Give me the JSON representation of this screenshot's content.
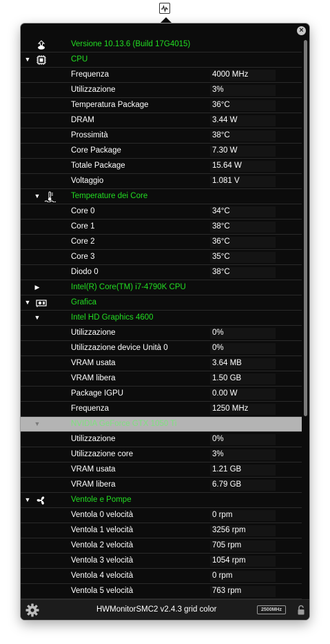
{
  "menubar": {
    "icon": "activity-monitor-icon"
  },
  "close": {
    "symbol": "×"
  },
  "rows": [
    {
      "type": "header",
      "indent": 0,
      "expand": "",
      "icon": "apple-os-icon",
      "label": "Versione 10.13.6 (Build 17G4015)",
      "value": ""
    },
    {
      "type": "header",
      "indent": 0,
      "expand": "down",
      "icon": "cpu-chip-icon",
      "label": "CPU",
      "value": ""
    },
    {
      "type": "item",
      "label": "Frequenza",
      "value": "4000 MHz"
    },
    {
      "type": "item",
      "label": "Utilizzazione",
      "value": "3%"
    },
    {
      "type": "item",
      "label": "Temperatura Package",
      "value": "36°C"
    },
    {
      "type": "item",
      "label": "DRAM",
      "value": "3.44 W"
    },
    {
      "type": "item",
      "label": "Prossimità",
      "value": "38°C"
    },
    {
      "type": "item",
      "label": "Core Package",
      "value": "7.30 W"
    },
    {
      "type": "item",
      "label": "Totale Package",
      "value": "15.64 W"
    },
    {
      "type": "item",
      "label": "Voltaggio",
      "value": "1.081 V"
    },
    {
      "type": "header",
      "indent": 1,
      "expand": "down",
      "icon": "thermometer-icon",
      "label": "Temperature dei Core",
      "value": ""
    },
    {
      "type": "item",
      "label": "Core 0",
      "value": "34°C"
    },
    {
      "type": "item",
      "label": "Core 1",
      "value": "38°C"
    },
    {
      "type": "item",
      "label": "Core 2",
      "value": "36°C"
    },
    {
      "type": "item",
      "label": "Core 3",
      "value": "35°C"
    },
    {
      "type": "item",
      "label": "Diodo 0",
      "value": "38°C"
    },
    {
      "type": "header",
      "indent": 1,
      "expand": "right",
      "icon": "",
      "label": "Intel(R) Core(TM) i7-4790K CPU",
      "value": ""
    },
    {
      "type": "header",
      "indent": 0,
      "expand": "down",
      "icon": "gpu-card-icon",
      "label": "Grafica",
      "value": ""
    },
    {
      "type": "header",
      "indent": 1,
      "expand": "down",
      "icon": "",
      "label": "Intel HD Graphics 4600",
      "value": ""
    },
    {
      "type": "item",
      "label": "Utilizzazione",
      "value": "0%"
    },
    {
      "type": "item",
      "label": "Utilizzazione device Unità 0",
      "value": "0%"
    },
    {
      "type": "item",
      "label": "VRAM usata",
      "value": "3.64 MB"
    },
    {
      "type": "item",
      "label": "VRAM libera",
      "value": "1.50 GB"
    },
    {
      "type": "item",
      "label": "Package IGPU",
      "value": "0.00 W"
    },
    {
      "type": "item",
      "label": "Frequenza",
      "value": "1250 MHz"
    },
    {
      "type": "header",
      "indent": 1,
      "expand": "down",
      "icon": "",
      "label": "NVIDIA GeForce GTX 1050 Ti",
      "value": "",
      "selected": true
    },
    {
      "type": "item",
      "label": "Utilizzazione",
      "value": "0%"
    },
    {
      "type": "item",
      "label": "Utilizzazione core",
      "value": "3%"
    },
    {
      "type": "item",
      "label": "VRAM usata",
      "value": "1.21 GB"
    },
    {
      "type": "item",
      "label": "VRAM libera",
      "value": "6.79 GB"
    },
    {
      "type": "header",
      "indent": 0,
      "expand": "down",
      "icon": "fan-icon",
      "label": "Ventole e Pompe",
      "value": ""
    },
    {
      "type": "item",
      "label": "Ventola 0 velocità",
      "value": "0 rpm"
    },
    {
      "type": "item",
      "label": "Ventola 1 velocità",
      "value": "3256 rpm"
    },
    {
      "type": "item",
      "label": "Ventola 2 velocità",
      "value": "705 rpm"
    },
    {
      "type": "item",
      "label": "Ventola 3 velocità",
      "value": "1054 rpm"
    },
    {
      "type": "item",
      "label": "Ventola 4 velocità",
      "value": "0 rpm"
    },
    {
      "type": "item",
      "label": "Ventola 5 velocità",
      "value": "763 rpm"
    }
  ],
  "footer": {
    "title": "HWMonitorSMC2 v2.4.3 grid color",
    "badge": "2500MHz",
    "settings_icon": "gear-icon",
    "lock_icon": "lock-icon"
  },
  "colors": {
    "background": "#0c0c0c",
    "header_text": "#22dd22",
    "item_text": "#ffffff",
    "selected_row": "#b4b4b4"
  }
}
